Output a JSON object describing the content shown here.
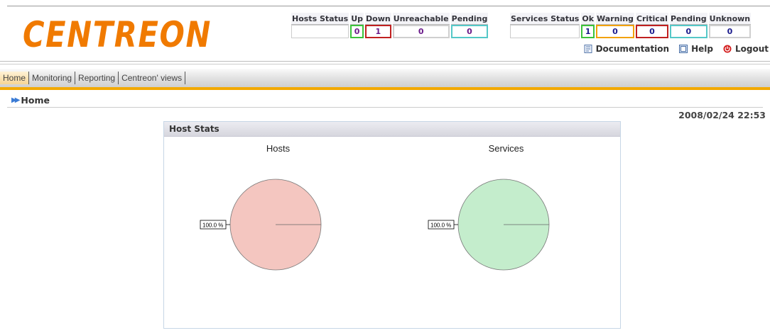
{
  "logo": {
    "text": "CENTREON",
    "color": "#f07a00"
  },
  "hosts_status": {
    "label": "Hosts Status",
    "columns": [
      "Up",
      "Down",
      "Unreachable",
      "Pending"
    ],
    "values": [
      "0",
      "1",
      "0",
      "0"
    ]
  },
  "services_status": {
    "label": "Services Status",
    "columns": [
      "Ok",
      "Warning",
      "Critical",
      "Pending",
      "Unknown"
    ],
    "values": [
      "1",
      "0",
      "0",
      "0",
      "0"
    ]
  },
  "top_links": [
    {
      "label": "Documentation",
      "icon": "documentation-icon"
    },
    {
      "label": "Help",
      "icon": "help-icon"
    },
    {
      "label": "Logout",
      "icon": "logout-icon"
    }
  ],
  "menu": [
    "Home",
    "Monitoring",
    "Reporting",
    "Centreon' views"
  ],
  "breadcrumb": "Home",
  "datetime": "2008/02/24 22:53",
  "panel": {
    "title": "Host Stats"
  },
  "chart_data": [
    {
      "type": "pie",
      "title": "Hosts",
      "slices": [
        {
          "value": 100.0,
          "label": "100.0 %",
          "color": "#f4c6c0"
        }
      ]
    },
    {
      "type": "pie",
      "title": "Services",
      "slices": [
        {
          "value": 100.0,
          "label": "100.0 %",
          "color": "#c4edcc"
        }
      ]
    }
  ],
  "colors": {
    "accent_orange": "#f2a900",
    "up_border": "#3cc23c",
    "down_border": "#c02020",
    "pending_border": "#55c8c8",
    "warning_border": "#f2a20b"
  }
}
